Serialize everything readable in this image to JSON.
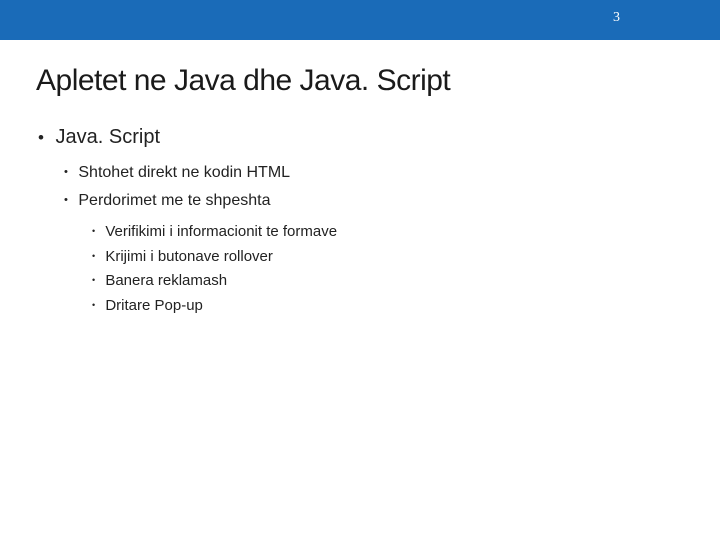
{
  "header": {
    "page_number": "3"
  },
  "slide": {
    "title": "Apletet ne Java dhe Java. Script"
  },
  "bullets": {
    "l1_0": "Java. Script",
    "l2_0": "Shtohet direkt ne kodin HTML",
    "l2_1": "Perdorimet me te shpeshta",
    "l3_0": "Verifikimi i informacionit te formave",
    "l3_1": "Krijimi i butonave rollover",
    "l3_2": "Banera reklamash",
    "l3_3": "Dritare Pop-up"
  }
}
